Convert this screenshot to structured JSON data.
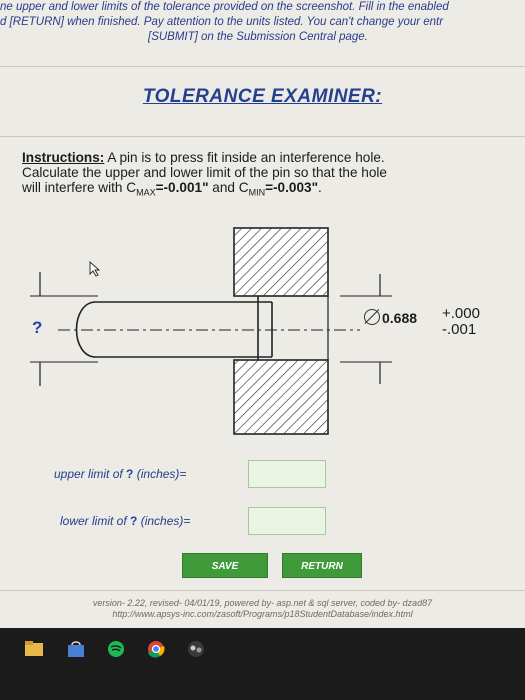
{
  "header_note": {
    "line1": "ne upper and lower limits of the tolerance provided on the screenshot. Fill in the enabled",
    "line2": "d [RETURN] when finished. Pay attention to the units listed. You can't change your entr",
    "line3": "[SUBMIT] on the Submission Central page."
  },
  "title": "TOLERANCE EXAMINER:",
  "instructions": {
    "label": "Instructions:",
    "text1": " A pin is to press fit inside an interference hole.",
    "line2": "Calculate the upper and lower limit of the pin so that the hole",
    "text3": "will interfere with C",
    "sub_max": "MAX",
    "cmax": "=-0.001\"",
    "and": " and C",
    "sub_min": "MIN",
    "cmin": "=-0.003\"",
    "end": "."
  },
  "diagram": {
    "unknown": "?",
    "hole_diameter": "0.688",
    "tol_upper": "+.000",
    "tol_lower": "-.001"
  },
  "form": {
    "upper_label": "upper limit of",
    "lower_label": "lower limit of",
    "q": "?",
    "units": "(inches)=",
    "upper_value": "",
    "lower_value": ""
  },
  "buttons": {
    "save": "SAVE",
    "return": "RETURN"
  },
  "footer": {
    "line1": "version- 2.22, revised- 04/01/19, powered by- asp.net & sql server, coded by- dzad87",
    "line2": "http://www.apsys-inc.com/zasoft/Programs/p18StudentDatabase/index.html"
  },
  "colors": {
    "title": "#24408f",
    "button": "#3f9a3a",
    "input_bg": "#eaf4e3"
  }
}
